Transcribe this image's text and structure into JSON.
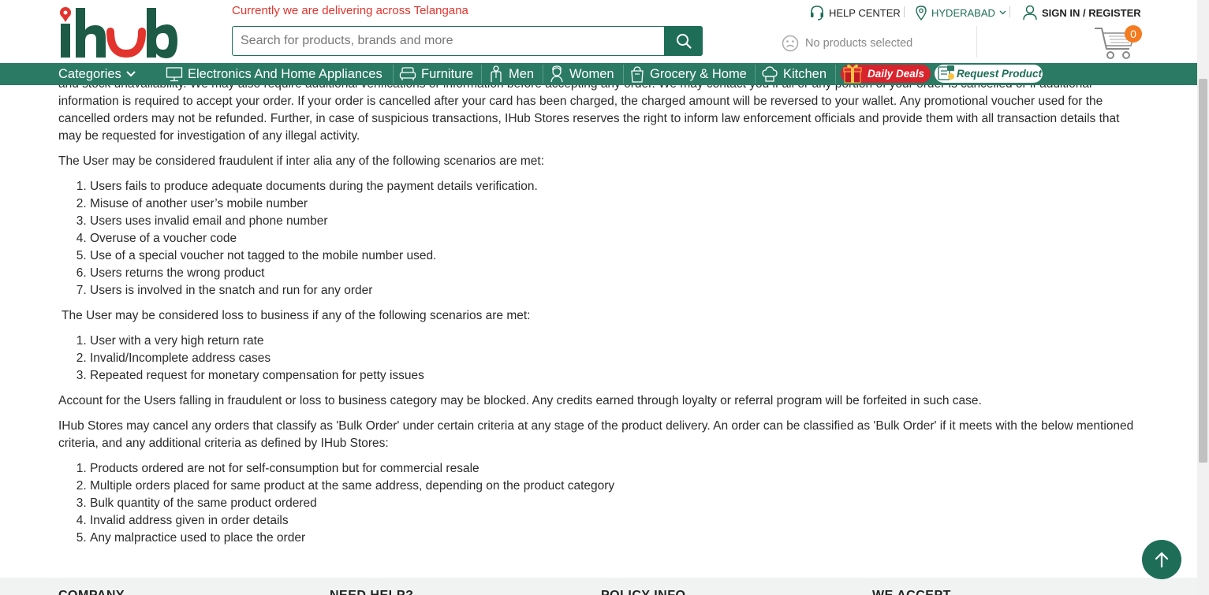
{
  "header": {
    "delivery_notice": "Currently we are delivering across Telangana",
    "search_placeholder": "Search for products, brands and more",
    "no_products": "No products selected",
    "help_center": "HELP CENTER",
    "city": "HYDERABAD",
    "sign_in": "SIGN IN / REGISTER",
    "cart_count": "0"
  },
  "nav": {
    "categories": "Categories",
    "items": [
      "Electronics And Home Appliances",
      "Furniture",
      "Men",
      "Women",
      "Grocery & Home",
      "Kitchen"
    ],
    "daily_deals": "Daily Deals",
    "request_product": "Request Product"
  },
  "content": {
    "clipped_line": "and stock unavailability. We may also require additional verifications or information before accepting any order. We may contact you if all or any portion of your order is cancelled or if additional",
    "para1": "information is required to accept your order. If your order is cancelled after your card has been charged, the charged amount will be reversed to your wallet. Any promotional voucher used for the cancelled orders may not be refunded. Further, in case of suspicious transactions, IHub Stores reserves the right to inform law enforcement officials and provide them with all transaction details that may be requested for investigation of any illegal activity.",
    "fraud_intro": "The User may be considered fraudulent if inter alia any of the following scenarios are met:",
    "fraud_list": [
      "Users fails to produce adequate documents during the payment details verification.",
      "Misuse of another user’s mobile number",
      "Users uses invalid email and phone number",
      "Overuse of a voucher code",
      "Use of a special voucher not tagged to the mobile number used.",
      "Users returns the wrong product",
      "Users is involved in the snatch and run for any order"
    ],
    "loss_intro": " The User may be considered loss to business if any of the following scenarios are met:",
    "loss_list": [
      "User with a very high return rate",
      "Invalid/Incomplete address cases",
      "Repeated request for monetary compensation for petty issues"
    ],
    "account_para": "Account for the Users falling in fraudulent or loss to business category may be blocked. Any credits earned through loyalty or referral program will be forfeited in such case.",
    "bulk_intro": "IHub Stores may cancel any orders that classify as 'Bulk Order' under certain criteria at any stage of the product delivery. An order can be classified as 'Bulk Order' if it meets with the below mentioned criteria, and any additional criteria as defined by IHub Stores:",
    "bulk_list": [
      "Products ordered are not for self-consumption but for commercial resale",
      "Multiple orders placed for same product at the same address, depending on the product category",
      "Bulk quantity of the same product ordered",
      "Invalid address given in order details",
      "Any malpractice used to place the order"
    ]
  },
  "footer": {
    "headings": [
      "COMPANY",
      "NEED HELP?",
      "POLICY INFO",
      "WE ACCEPT"
    ]
  },
  "colors": {
    "brand_green": "#1e6e57",
    "nav_green": "#2b7a64",
    "accent_red": "#e2342d",
    "badge_orange": "#f47b1f"
  }
}
